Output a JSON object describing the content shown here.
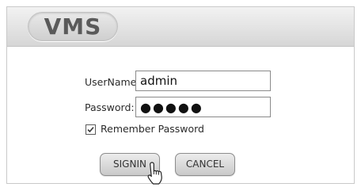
{
  "header": {
    "logo_text": "VMS"
  },
  "login": {
    "username_label": "UserName:",
    "username_value": "admin",
    "password_label": "Password:",
    "password_value": "●●●●●",
    "remember_label": "Remember Password",
    "remember_checked": true,
    "signin_label": "SIGNIN",
    "cancel_label": "CANCEL"
  },
  "icons": {
    "checkbox": "checkmark-icon",
    "pointer": "hand-pointer-icon"
  }
}
